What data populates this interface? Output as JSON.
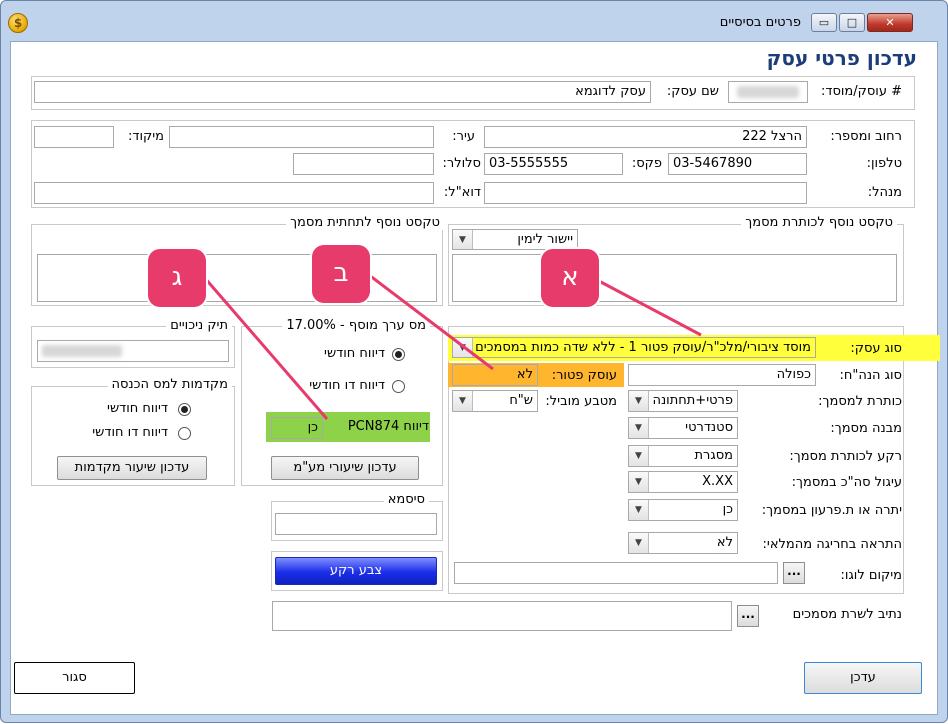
{
  "window": {
    "title": "פרטים בסיסיים",
    "minimize": "▭",
    "maximize": "□",
    "close": "✕",
    "app_icon": "coin-icon"
  },
  "header": {
    "title": "עדכון פרטי עסק"
  },
  "business": {
    "id_label": "# עוסק/מוסד:",
    "name_label": "שם עסק:",
    "name_value": "עסק לדוגמא"
  },
  "address": {
    "street_label": "רחוב ומספר:",
    "street_value": "הרצל 222",
    "city_label": "עיר:",
    "city_value": "",
    "zip_label": "מיקוד:",
    "zip_value": "",
    "phone_label": "טלפון:",
    "phone_value": "03-5467890",
    "fax_label": "פקס:",
    "fax_value": "03-5555555",
    "mobile_label": "סלולר:",
    "mobile_value": "",
    "manager_label": "מנהל:",
    "manager_value": "",
    "email_label": "דוא\"ל:",
    "email_value": ""
  },
  "header_text": {
    "legend": "טקסט נוסף לכותרת מסמך",
    "align_value": "יישור לימין",
    "text_value": ""
  },
  "footer_text": {
    "legend": "טקסט נוסף לתחתית מסמך",
    "text_value": ""
  },
  "deductions": {
    "legend": "תיק ניכויים"
  },
  "advances": {
    "legend": "מקדמות למס הכנסה",
    "monthly": "דיווח חודשי",
    "bimonthly": "דיווח דו חודשי",
    "update_button": "עדכון שיעור מקדמות"
  },
  "vat": {
    "legend": "מס ערך מוסף - 17.00%",
    "monthly": "דיווח חודשי",
    "bimonthly": "דיווח דו חודשי",
    "pcn_label": "דיווח PCN874",
    "pcn_value": "כן",
    "update_button": "עדכון שיעורי מע\"מ"
  },
  "password": {
    "legend": "סיסמא",
    "value": ""
  },
  "bg_color": {
    "button": "צבע רקע"
  },
  "doc_settings": {
    "business_type_label": "סוג עסק:",
    "business_type_value": "מוסד ציבורי/מלכ\"ר/עוסק פטור 1 - ללא שדה כמות במסמכים",
    "exempt_label": "עוסק פטור:",
    "exempt_value": "לא",
    "bookkeeping_label": "סוג הנה\"ח:",
    "bookkeeping_value": "כפולה",
    "currency_label": "מטבע מוביל:",
    "currency_value": "ש\"ח",
    "doc_header_label": "כותרת למסמך:",
    "doc_header_value": "פרטי+תחתונה",
    "doc_structure_label": "מבנה מסמך:",
    "doc_structure_value": "סטנדרטי",
    "header_bg_label": "רקע לכותרת מסמך:",
    "header_bg_value": "מסגרת",
    "rounding_label": "עיגול סה\"כ במסמך:",
    "rounding_value": "X.XX",
    "balance_label": "יתרה או ת.פרעון במסמך:",
    "balance_value": "כן",
    "overflow_label": "התראה בחריגה מהמלאי:",
    "overflow_value": "לא",
    "logo_label": "מיקום לוגו:",
    "logo_value": "",
    "path_label": "נתיב לשרת מסמכים",
    "path_value": "",
    "browse": "..."
  },
  "actions": {
    "update": "עדכן",
    "close": "סגור"
  },
  "callouts": {
    "a": "א",
    "b": "ב",
    "g": "ג"
  },
  "colors": {
    "highlight_yellow": "#ffff3b",
    "highlight_orange": "#ffb62e",
    "highlight_green": "#8ed24a",
    "callout": "#e63b6b",
    "title_blue": "#1c3c7a"
  }
}
